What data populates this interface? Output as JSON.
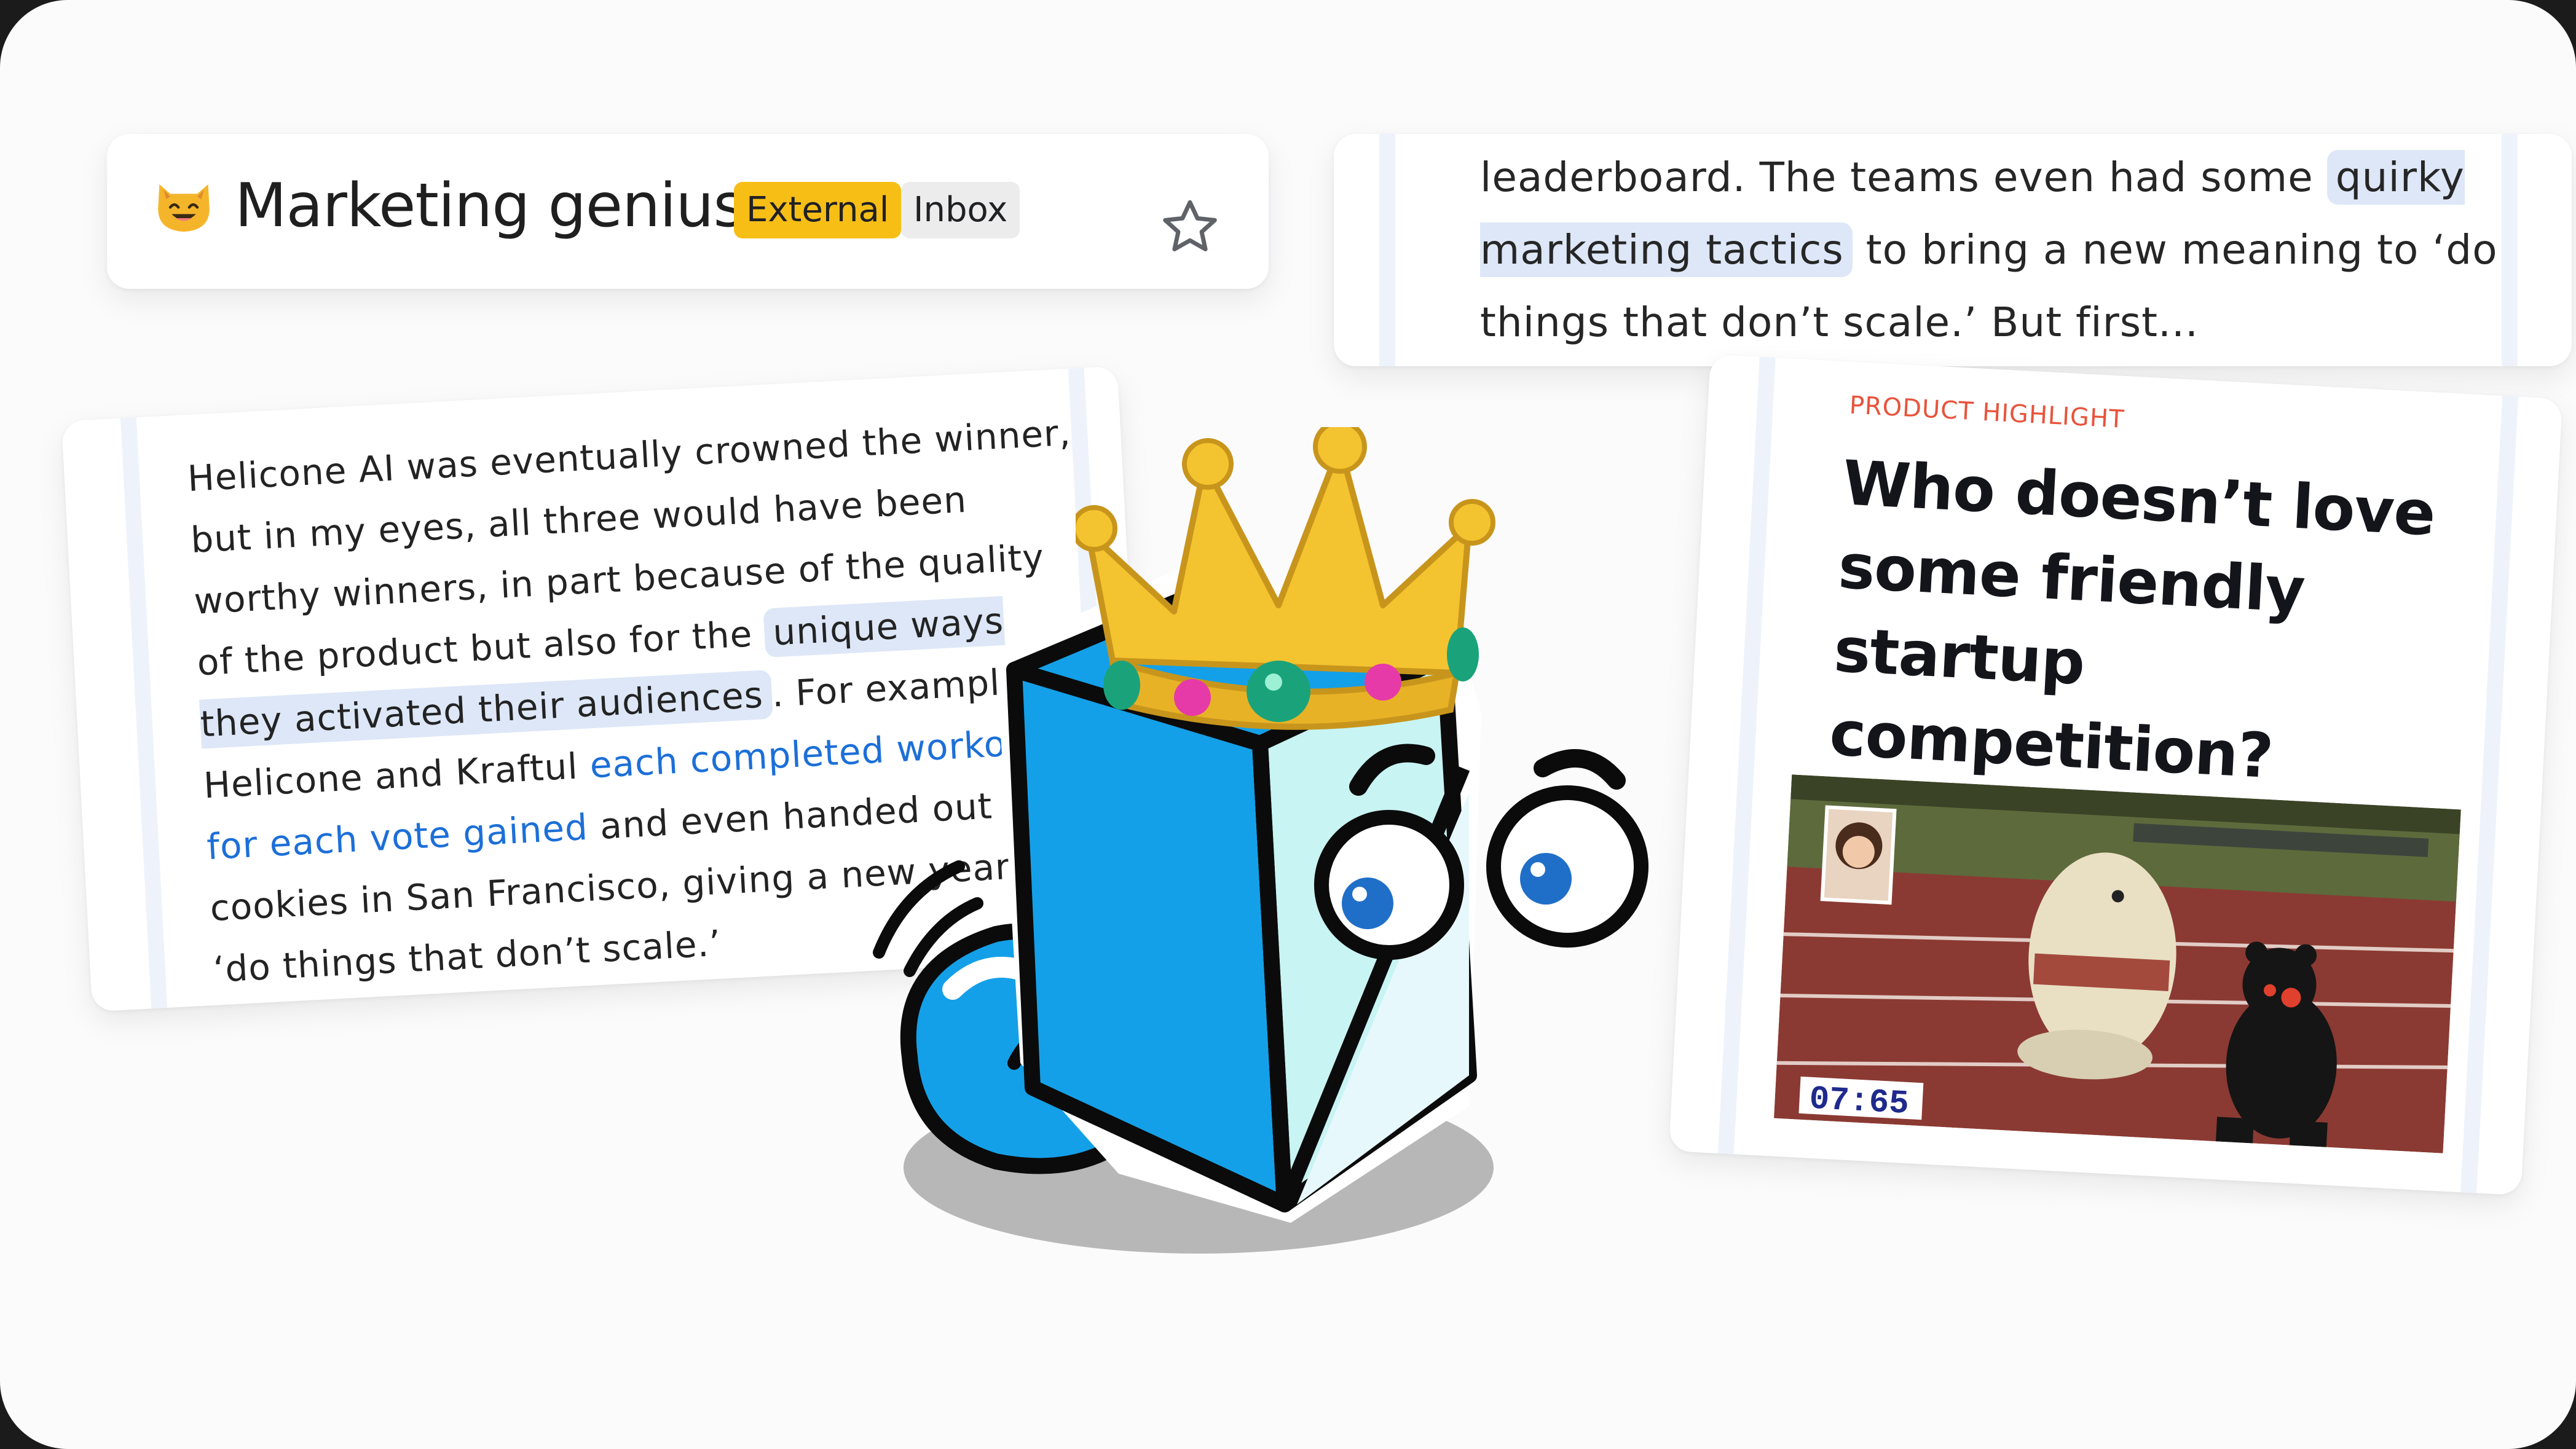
{
  "subject": {
    "emoji": "smiling-cat-emoji",
    "title": "Marketing genius",
    "labels": [
      "External",
      "Inbox"
    ],
    "star_icon": "star-outline-icon"
  },
  "quote": {
    "line1": "leaderboard. The teams even had some ",
    "hl": "quirky marketing tactics",
    "rest": " to bring a new meaning to ‘do things that don’t scale.’ But first..."
  },
  "body": {
    "p1": "Helicone AI was eventually crowned the winner, but in my eyes, all three would have been worthy winners, in part because of the quality of the product but also for the ",
    "hl": "unique ways they activated their audiences",
    "p2": ". For example, Helicone and Kraftul ",
    "link": "each completed workouts for each vote gained",
    "p3": " and even handed out cookies in San Francisco, giving a new year to ‘do things that don’t scale.’"
  },
  "product": {
    "eyebrow": "PRODUCT HIGHLIGHT",
    "headline": "Who doesn’t love some friendly startup competition?",
    "gif_timer": "07:65",
    "gif_desc_icon": "mascot-race-image"
  },
  "mascot": {
    "icon": "crowned-cube-mascot-icon"
  },
  "colors": {
    "external_chip": "#f7be16",
    "highlight": "#dde7f7",
    "link": "#1c6fd8",
    "eyebrow": "#e8533b",
    "mascot_blue": "#14a0e8"
  }
}
